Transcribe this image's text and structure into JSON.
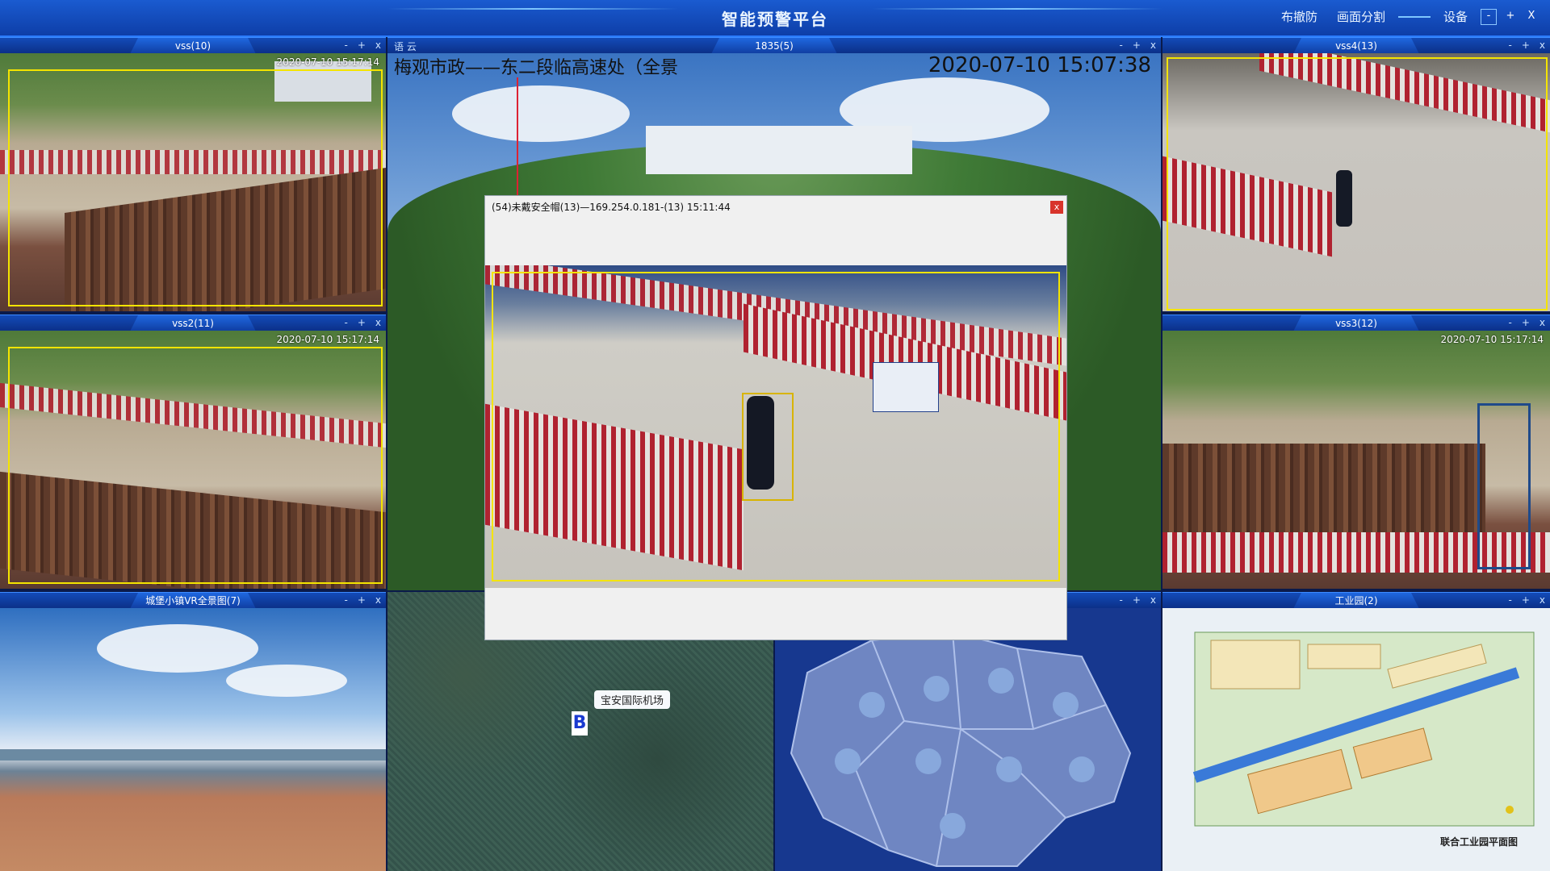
{
  "app": {
    "title": "智能预警平台",
    "actions": [
      "布撤防",
      "画面分割"
    ],
    "device_label": "设备",
    "window_controls": [
      "-",
      "+",
      "X"
    ]
  },
  "panels": {
    "p1": {
      "title": "vss(10)",
      "timestamp": "2020-07-10 15:17:14"
    },
    "p2": {
      "title": "1835(5)",
      "left_tab": "语 云",
      "overlay_left": "梅观市政——东二段临高速处（全景",
      "overlay_right": "2020-07-10 15:07:38"
    },
    "p3": {
      "title": "vss4(13)"
    },
    "p4": {
      "title": "vss2(11)",
      "timestamp": "2020-07-10 15:17:14"
    },
    "p5": {
      "title": "vss3(12)",
      "timestamp": "2020-07-10 15:17:14"
    },
    "p6": {
      "title": "城堡小镇VR全景图(7)"
    },
    "p7": {
      "map_label": "宝安国际机场",
      "marker": "B"
    },
    "p9": {
      "title": "工业园(2)",
      "caption": "联合工业园平面图"
    },
    "panel_controls": [
      "-",
      "+",
      "x"
    ]
  },
  "dialog": {
    "title": "(54)未戴安全帽(13)—169.254.0.181-(13)  15:11:44",
    "close": "x"
  },
  "colors": {
    "accent": "#1a5bd0",
    "bg": "#0a1a4a",
    "detect_box": "#f4e400",
    "close_red": "#d8342b"
  }
}
